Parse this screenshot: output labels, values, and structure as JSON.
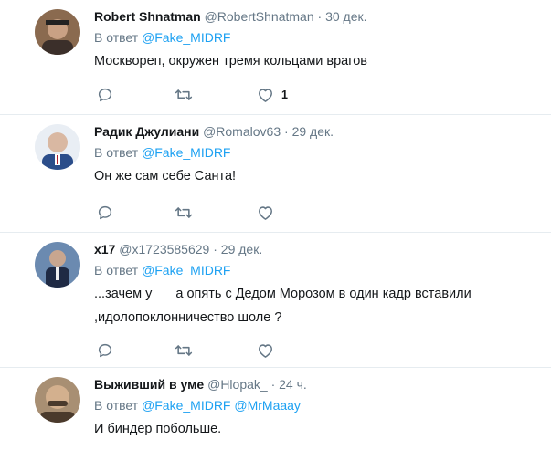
{
  "tweets": [
    {
      "name": "Robert Shnatman",
      "handle": "@RobertShnatman",
      "time": "30 дек.",
      "reply_prefix": "В ответ",
      "mentions": [
        "@Fake_MIDRF"
      ],
      "text": "Москвореп, окружен тремя кольцами врагов",
      "like_count": "1",
      "avatar_colors": [
        "#8a6a4f",
        "#3b2f2a"
      ]
    },
    {
      "name": "Радик Джулиани",
      "handle": "@Romalov63",
      "time": "29 дек.",
      "reply_prefix": "В ответ",
      "mentions": [
        "@Fake_MIDRF"
      ],
      "text": "Он же сам себе Санта!",
      "like_count": "",
      "avatar_colors": [
        "#d9b8a2",
        "#2b4d8a"
      ]
    },
    {
      "name": "x17",
      "handle": "@x1723585629",
      "time": "29 дек.",
      "reply_prefix": "В ответ",
      "mentions": [
        "@Fake_MIDRF"
      ],
      "text_part1": "...зачем у",
      "text_part2": "а опять с Дедом Морозом в один кадр вставили",
      "text_line2": ",идолопоклонничество шоле ?",
      "like_count": "",
      "avatar_colors": [
        "#6b8ab0",
        "#1f2a44"
      ]
    },
    {
      "name": "Выживший в уме",
      "handle": "@Hlopak_",
      "time": "24 ч.",
      "reply_prefix": "В ответ",
      "mentions": [
        "@Fake_MIDRF",
        "@MrMaaay"
      ],
      "text": "И биндер побольше.",
      "avatar_colors": [
        "#a88f73",
        "#4a3a2c"
      ]
    }
  ],
  "separator_char": "·",
  "colors": {
    "accent": "#1da1f2",
    "secondary_text": "#657786",
    "icon": "#657786",
    "divider": "#e6ecf0"
  },
  "icons": [
    "reply-icon",
    "retweet-icon",
    "like-icon"
  ]
}
